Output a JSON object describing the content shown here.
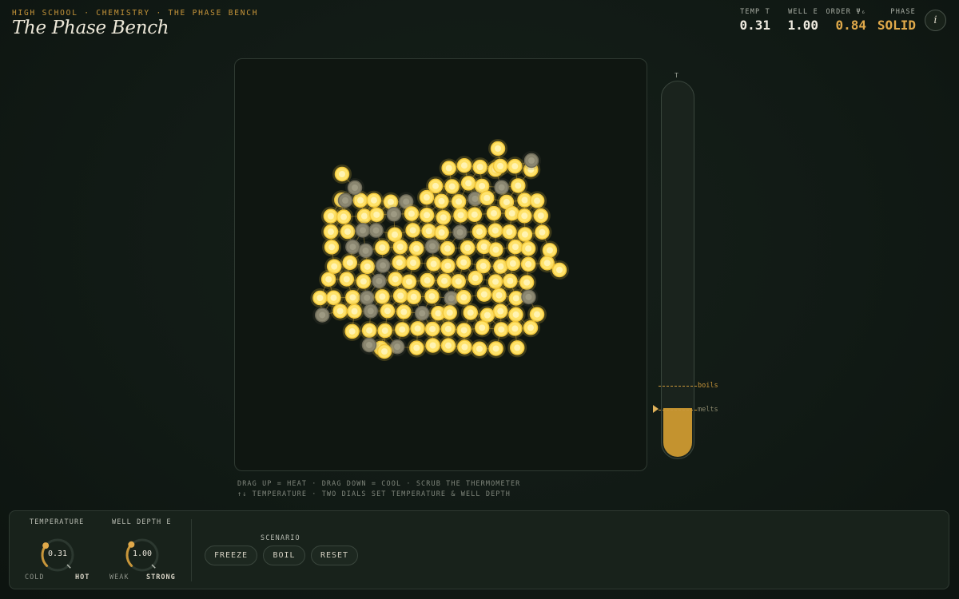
{
  "header": {
    "breadcrumb": "HIGH SCHOOL · CHEMISTRY · THE PHASE BENCH",
    "title": "The Phase Bench",
    "info_icon": "info-icon"
  },
  "stats": {
    "temp": {
      "label": "TEMP T",
      "value": "0.31"
    },
    "well": {
      "label": "WELL E",
      "value": "1.00"
    },
    "order": {
      "label": "ORDER Ψ₆",
      "value": "0.84"
    },
    "phase": {
      "label": "PHASE",
      "value": "SOLID"
    }
  },
  "thermometer": {
    "label": "T",
    "boils_label": "boils",
    "melts_label": "melts",
    "level": 0.31
  },
  "hints": {
    "line1": "DRAG UP = HEAT · DRAG DOWN = COOL · SCRUB THE THERMOMETER",
    "line2": "↑↓ TEMPERATURE · TWO DIALS SET TEMPERATURE & WELL DEPTH"
  },
  "controls": {
    "temperature": {
      "label": "TEMPERATURE",
      "value": "0.31",
      "min_label": "COLD",
      "max_label": "HOT",
      "level": 0.31
    },
    "well_depth": {
      "label": "WELL DEPTH E",
      "value": "1.00",
      "min_label": "WEAK",
      "max_label": "STRONG",
      "level": 0.33
    },
    "scenario": {
      "label": "SCENARIO",
      "buttons": [
        "FREEZE",
        "BOIL",
        "RESET"
      ]
    }
  },
  "colors": {
    "accent": "#c8963a",
    "particle_bright": "#ffe36b",
    "particle_dim": "#8a8670",
    "bond": "#c9a23a"
  }
}
